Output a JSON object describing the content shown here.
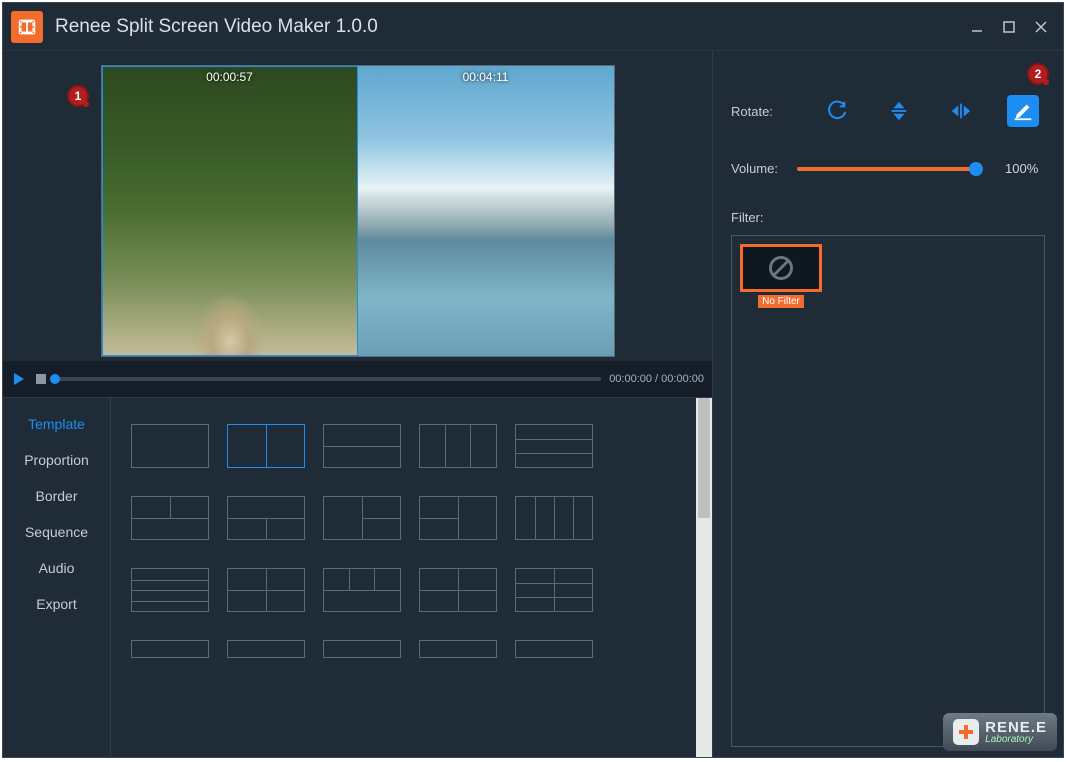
{
  "app": {
    "title": "Renee Split Screen Video Maker 1.0.0"
  },
  "preview": {
    "clips": [
      {
        "timestamp": "00:00:57",
        "selected": true
      },
      {
        "timestamp": "00:04:11",
        "selected": false
      }
    ]
  },
  "playbar": {
    "time_readout": "00:00:00 / 00:00:00"
  },
  "sidetabs": [
    "Template",
    "Proportion",
    "Border",
    "Sequence",
    "Audio",
    "Export"
  ],
  "sidetab_active": 0,
  "right": {
    "rotate_label": "Rotate:",
    "volume_label": "Volume:",
    "volume_value": "100%",
    "filter_label": "Filter:"
  },
  "filters": [
    {
      "name": "No Filter",
      "selected": true
    }
  ],
  "annotations": {
    "badge1": "1",
    "badge2": "2"
  },
  "brand": {
    "name": "RENE.E",
    "sub": "Laboratory"
  }
}
